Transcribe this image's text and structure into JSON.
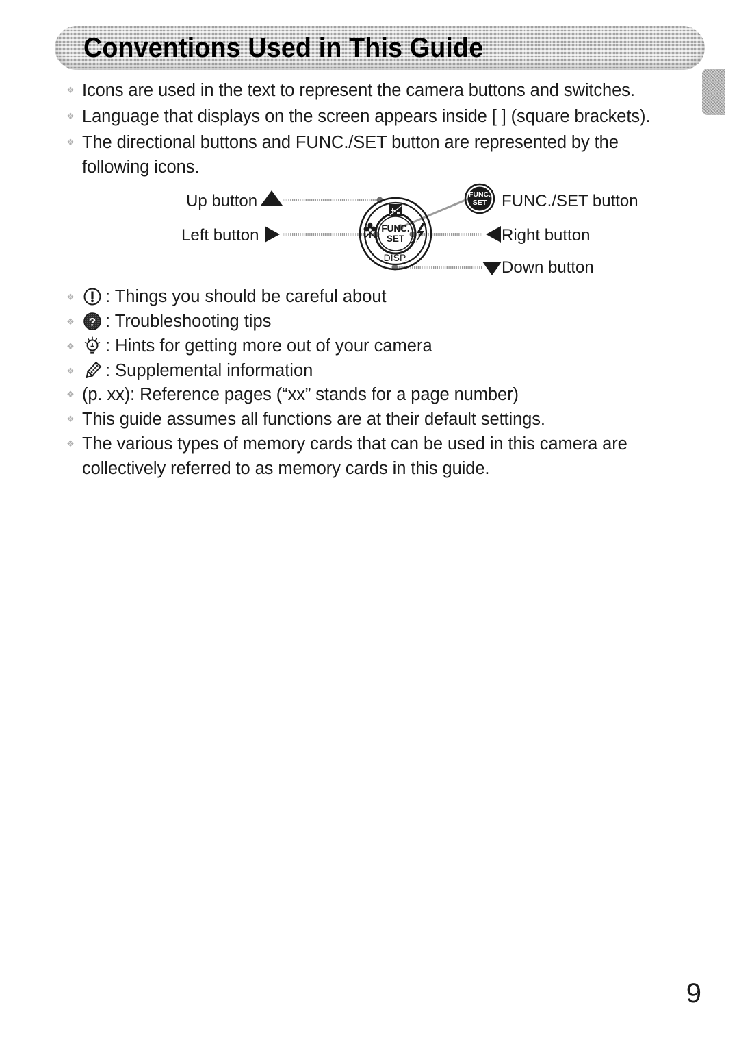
{
  "page": {
    "title": "Conventions Used in This Guide",
    "number": "9"
  },
  "bullets": {
    "marker": "❖",
    "items": [
      "Icons are used in the text to represent the camera buttons and switches.",
      "Language that displays on the screen appears inside [ ] (square brackets).",
      "The directional buttons and FUNC./SET button are represented by the\nfollowing icons."
    ],
    "tail_items": [
      "(p. xx): Reference pages (“xx” stands for a page number)",
      "This guide assumes all functions are at their default settings.",
      "The various types of memory cards that can be used in this camera are\ncollectively referred to as memory cards in this guide."
    ]
  },
  "icon_legend": [
    {
      "icon": "warning-exclamation-icon",
      "text": ": Things you should be careful about"
    },
    {
      "icon": "troubleshooting-question-icon",
      "text": ": Troubleshooting tips"
    },
    {
      "icon": "hint-lightbulb-icon",
      "text": ": Hints for getting more out of your camera"
    },
    {
      "icon": "supplemental-pencil-icon",
      "text": ": Supplemental information"
    }
  ],
  "diagram": {
    "labels": {
      "up": "Up button",
      "left": "Left button",
      "func_set": "FUNC./SET button",
      "right": "Right button",
      "down": "Down button"
    },
    "dial": {
      "center_line1": "FUNC.",
      "center_line2": "SET",
      "bottom_text": "DISP.",
      "left_icon": "macro-flower-icon",
      "right_icon": "flash-icon",
      "top_icon": "exposure-compensation-icon"
    },
    "callout_button": {
      "line1": "FUNC.",
      "line2": "SET"
    }
  },
  "colors": {
    "ink": "#1b1b1b",
    "banner": "#cfcfcf",
    "bullet": "#b0b0b0",
    "leader": "#9a9a9a"
  }
}
